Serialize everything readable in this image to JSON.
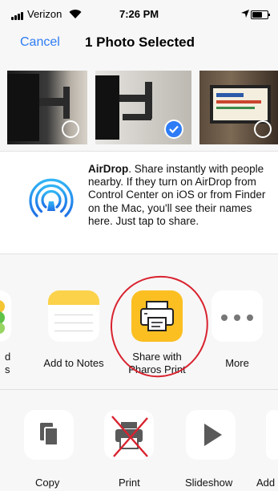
{
  "status_bar": {
    "carrier": "Verizon",
    "time": "7:26 PM"
  },
  "nav": {
    "cancel_label": "Cancel",
    "title": "1 Photo Selected"
  },
  "photos": [
    {
      "selected": false
    },
    {
      "selected": true
    },
    {
      "selected": false
    }
  ],
  "airdrop": {
    "title": "AirDrop",
    "description": ". Share instantly with people nearby. If they turn on AirDrop from Control Center on iOS or from Finder on the Mac, you'll see their names here. Just tap to share."
  },
  "share_apps": {
    "partial_left": [
      "d",
      "s"
    ],
    "add_to_notes": "Add to Notes",
    "pharos_line1": "Share with",
    "pharos_line2": "Pharos Print",
    "more": "More"
  },
  "actions": {
    "copy": "Copy",
    "print": "Print",
    "slideshow": "Slideshow",
    "partial_right": "Add"
  },
  "colors": {
    "accent": "#2d7cf6",
    "pharos": "#fbbf22",
    "annotation": "#d9232f"
  }
}
